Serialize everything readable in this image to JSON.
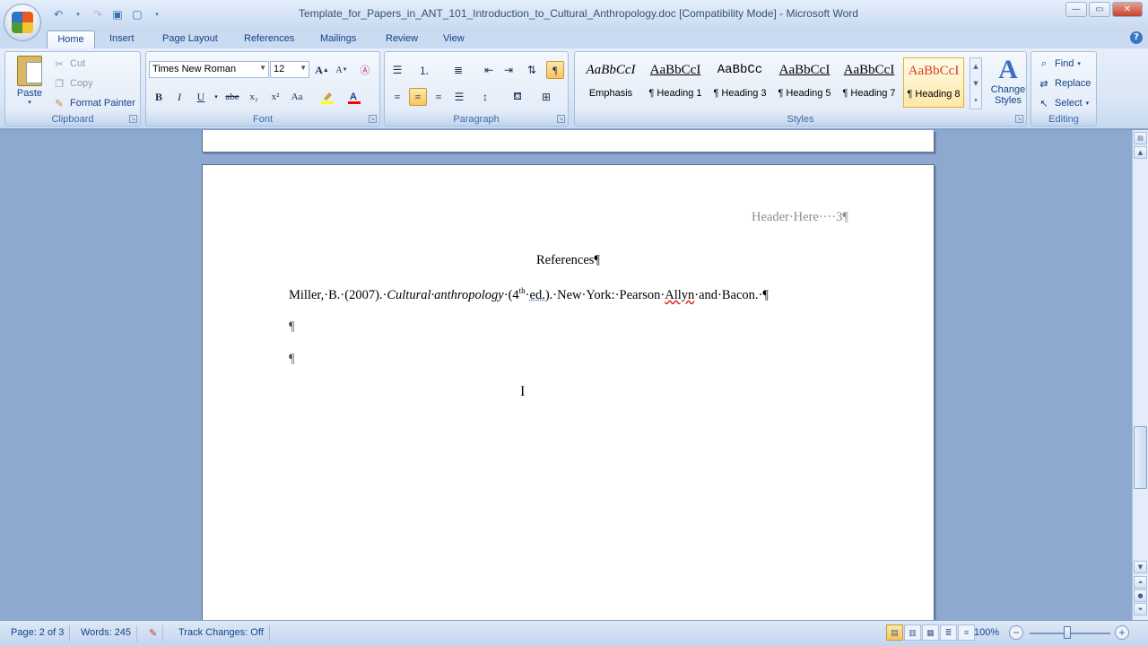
{
  "window": {
    "title": "Template_for_Papers_in_ANT_101_Introduction_to_Cultural_Anthropology.doc [Compatibility Mode] - Microsoft Word"
  },
  "tabs": [
    "Home",
    "Insert",
    "Page Layout",
    "References",
    "Mailings",
    "Review",
    "View"
  ],
  "active_tab": "Home",
  "clipboard": {
    "paste": "Paste",
    "cut": "Cut",
    "copy": "Copy",
    "format_painter": "Format Painter",
    "group_label": "Clipboard"
  },
  "font": {
    "name": "Times New Roman",
    "size": "12",
    "group_label": "Font",
    "bold": "B",
    "italic": "I",
    "underline": "U",
    "strike": "abe",
    "subscript": "x₂",
    "superscript": "x²",
    "change_case": "Aa",
    "grow": "A",
    "shrink": "A",
    "highlight_color": "#ffff00",
    "font_color": "#ff0000"
  },
  "paragraph": {
    "group_label": "Paragraph",
    "show_marks_active": true
  },
  "styles": {
    "group_label": "Styles",
    "items": [
      {
        "sample": "AaBbCcI",
        "name": "Emphasis"
      },
      {
        "sample": "AaBbCcI",
        "name": "¶ Heading 1"
      },
      {
        "sample": "AaBbCc",
        "name": "¶ Heading 3"
      },
      {
        "sample": "AaBbCcI",
        "name": "¶ Heading 5"
      },
      {
        "sample": "AaBbCcI",
        "name": "¶ Heading 7"
      },
      {
        "sample": "AaBbCcI",
        "name": "¶ Heading 8"
      }
    ],
    "selected": "¶ Heading 8",
    "change_styles": "Change Styles"
  },
  "editing": {
    "group_label": "Editing",
    "find": "Find",
    "replace": "Replace",
    "select": "Select"
  },
  "document": {
    "header": "Header·Here····3¶",
    "heading": "References¶",
    "citation": {
      "author": "Miller,·B.·(2007).·",
      "title": "Cultural·anthropology",
      "edition_pre": "·(4",
      "edition_sup": "th",
      "edition_post": "·",
      "ed": "ed.",
      "rest": ").·New·York:·Pearson·",
      "allyn": "Allyn",
      "end": "·and·Bacon.·¶"
    },
    "empty_para_1": "¶",
    "empty_para_2": "¶"
  },
  "statusbar": {
    "page": "Page: 2 of 3",
    "words": "Words: 245",
    "track_changes": "Track Changes: Off",
    "zoom": "100%"
  }
}
